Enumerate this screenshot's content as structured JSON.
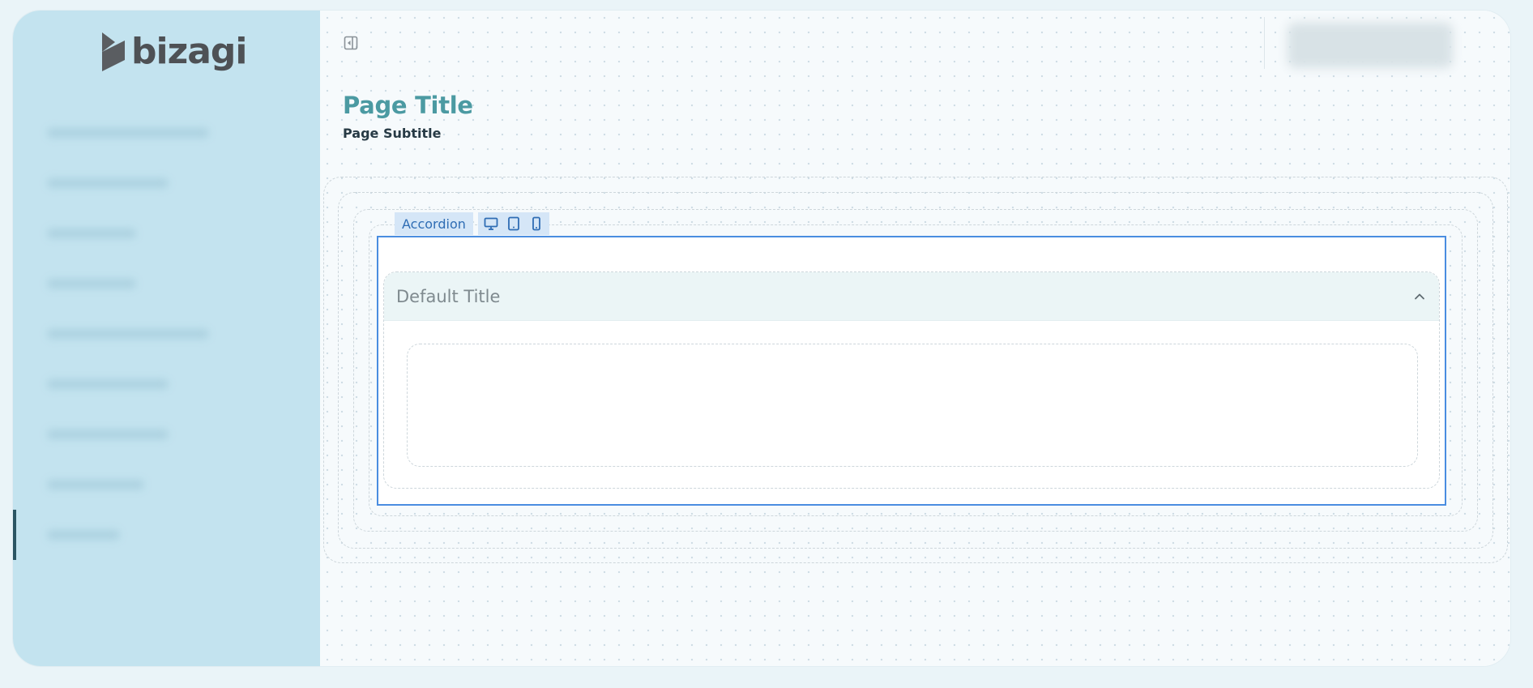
{
  "brand": {
    "name": "bizagi",
    "color": "#4e5155"
  },
  "sidebar": {
    "background": "#c3e3ef",
    "items": [
      {
        "id": "item-1",
        "blur_width": 200
      },
      {
        "id": "item-2",
        "blur_width": 150
      },
      {
        "id": "item-3",
        "blur_width": 110
      },
      {
        "id": "item-4",
        "blur_width": 110
      },
      {
        "id": "item-5",
        "blur_width": 200
      },
      {
        "id": "item-6",
        "blur_width": 150
      },
      {
        "id": "item-7",
        "blur_width": 150
      },
      {
        "id": "item-8",
        "blur_width": 120
      },
      {
        "id": "item-9",
        "blur_width": 90,
        "active": true
      }
    ]
  },
  "header": {
    "collapse_icon": "panel-collapse-icon",
    "user_chip": "avatar"
  },
  "page": {
    "title": "Page Title",
    "subtitle": "Page Subtitle",
    "title_color": "#4b9aa2"
  },
  "canvas": {
    "selected_control_label": "Accordion",
    "device_icons": [
      "desktop-icon",
      "tablet-icon",
      "mobile-icon"
    ],
    "accent": "#4a8de0"
  },
  "accordion": {
    "title": "Default Title",
    "expanded": true,
    "toggle_icon": "chevron-up-icon"
  }
}
